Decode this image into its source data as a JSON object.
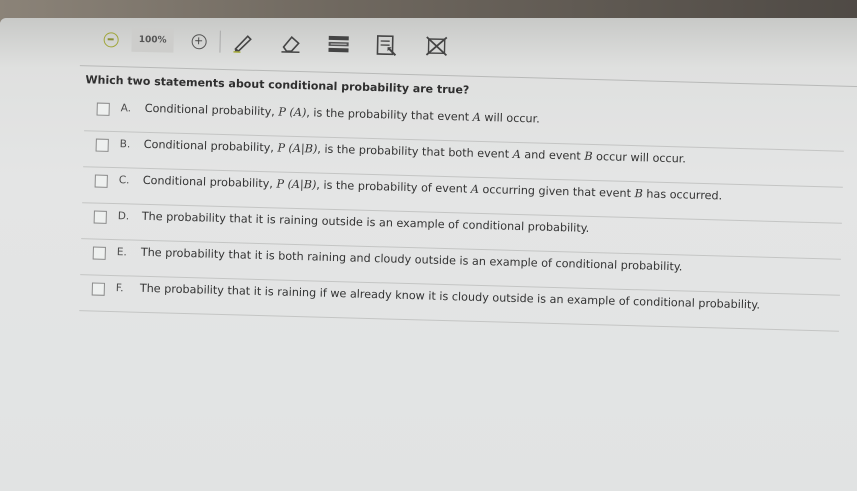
{
  "toolbar": {
    "zoom_out_icon": "zoom-out-icon",
    "zoom_level": "100%",
    "zoom_in_icon": "zoom-in-icon",
    "tools": [
      "pencil-icon",
      "eraser-icon",
      "highlighter-icon",
      "answer-masking-icon",
      "cross-out-icon"
    ]
  },
  "question": {
    "prompt": "Which two statements about conditional probability are true?",
    "options": [
      {
        "letter": "A.",
        "pre": "Conditional probability, ",
        "math": "P (A)",
        "post": ", is the probability that event ",
        "math2": "A",
        "post2": " will occur.",
        "checked": false
      },
      {
        "letter": "B.",
        "pre": "Conditional probability, ",
        "math": "P (A|B)",
        "post": ", is the probability that both event ",
        "math2": "A",
        "post2": " and event ",
        "math3": "B",
        "post3": " occur will occur.",
        "checked": false
      },
      {
        "letter": "C.",
        "pre": "Conditional probability, ",
        "math": "P (A|B)",
        "post": ", is the probability of event ",
        "math2": "A",
        "post2": " occurring given that event ",
        "math3": "B",
        "post3": " has occurred.",
        "checked": false
      },
      {
        "letter": "D.",
        "pre": "The probability that it is raining outside is an example of conditional probability.",
        "checked": false
      },
      {
        "letter": "E.",
        "pre": "The probability that it is both raining and cloudy outside is an example of conditional probability.",
        "checked": false
      },
      {
        "letter": "F.",
        "pre": "The probability that it is raining if we already know it is cloudy outside is an example of conditional probability.",
        "checked": false
      }
    ]
  }
}
